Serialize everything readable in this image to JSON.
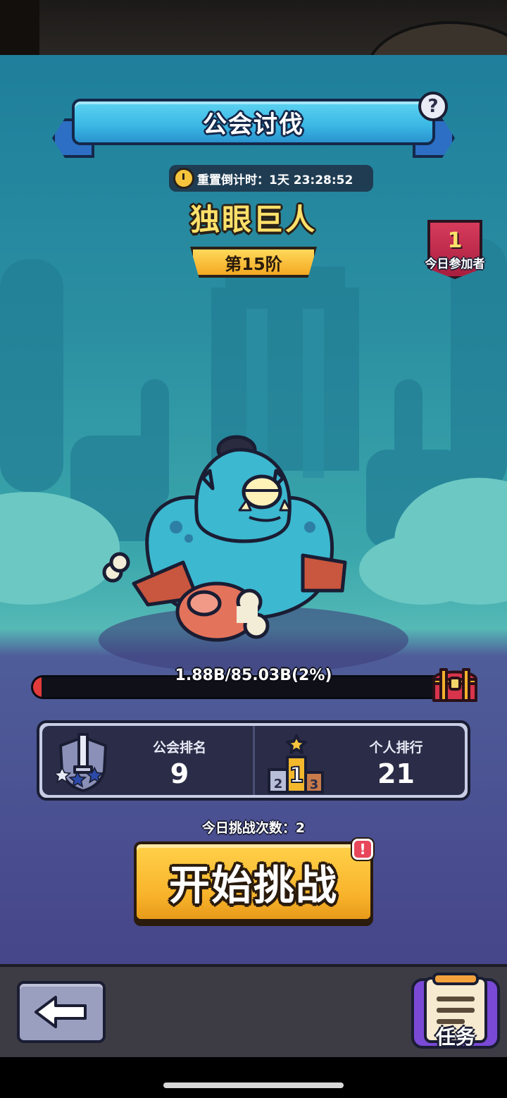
{
  "header": {
    "title": "公会讨伐",
    "help_symbol": "?"
  },
  "timer": {
    "label": "重置倒计时：1天 23:28:52"
  },
  "boss": {
    "name": "独眼巨人",
    "stage": "第15阶"
  },
  "participants": {
    "count": "1",
    "label": "今日参加者"
  },
  "hp": {
    "text": "1.88B/85.03B(2%)",
    "fraction": 0.02
  },
  "rankings": {
    "guild": {
      "label": "公会排名",
      "value": "9"
    },
    "personal": {
      "label": "个人排行",
      "value": "21"
    },
    "podium": {
      "first": "1",
      "second": "2",
      "third": "3"
    }
  },
  "attempts": {
    "label": "今日挑战次数：2"
  },
  "start_button": {
    "label": "开始挑战",
    "alert": "!"
  },
  "nav": {
    "quest_label": "任务"
  },
  "colors": {
    "banner": "#3ab7e4",
    "boss_name": "#ffe16a",
    "button": "#f8b22a",
    "hp_fill": "#e13b3b"
  }
}
